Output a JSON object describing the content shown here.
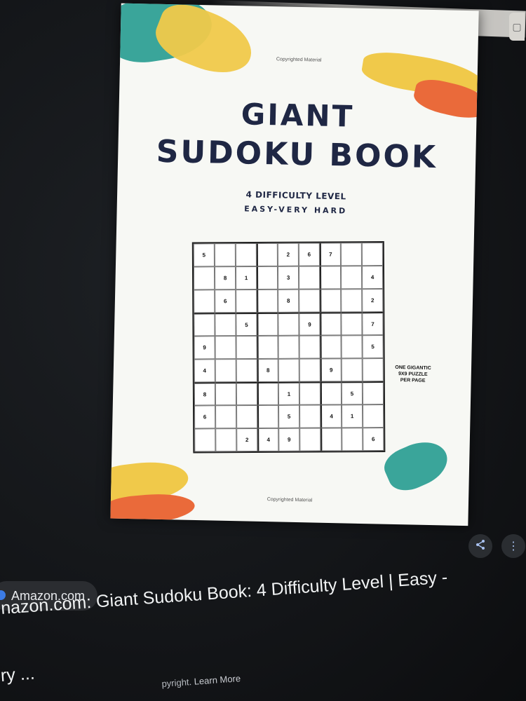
{
  "book": {
    "copyright_top": "Copyrighted Material",
    "title_line1": "GIANT",
    "title_line2": "SUDOKU BOOK",
    "subtitle_line1": "4 DIFFICULTY LEVEL",
    "subtitle_line2": "EASY-VERY HARD",
    "side_note": [
      "ONE GIGANTIC",
      "9X9 PUZZLE",
      "PER PAGE"
    ],
    "copyright_bottom": "Copyrighted Material",
    "sudoku_grid": [
      [
        "5",
        "",
        "",
        "",
        "2",
        "6",
        "7",
        "",
        ""
      ],
      [
        "",
        "8",
        "1",
        "",
        "3",
        "",
        "",
        "",
        "4"
      ],
      [
        "",
        "6",
        "",
        "",
        "8",
        "",
        "",
        "",
        "2"
      ],
      [
        "",
        "",
        "5",
        "",
        "",
        "9",
        "",
        "",
        "7"
      ],
      [
        "9",
        "",
        "",
        "",
        "",
        "",
        "",
        "",
        "5"
      ],
      [
        "4",
        "",
        "",
        "8",
        "",
        "",
        "9",
        "",
        ""
      ],
      [
        "8",
        "",
        "",
        "",
        "1",
        "",
        "",
        "5",
        ""
      ],
      [
        "6",
        "",
        "",
        "",
        "5",
        "",
        "4",
        "1",
        ""
      ],
      [
        "",
        "",
        "2",
        "4",
        "9",
        "",
        "",
        "",
        "6"
      ]
    ]
  },
  "result": {
    "source_name": "Amazon.com",
    "title_line1": "nazon.com: Giant Sudoku Book: 4 Difficulty Level | Easy -",
    "title_line2": "ry ...",
    "rights_text": "pyright.",
    "learn_more": "Learn More"
  },
  "icons": {
    "share": "share-icon",
    "more": "more-vert-icon"
  },
  "colors": {
    "title_navy": "#1f2744",
    "teal": "#3aa59a",
    "yellow": "#f0c94a",
    "orange": "#ea6a3a"
  }
}
